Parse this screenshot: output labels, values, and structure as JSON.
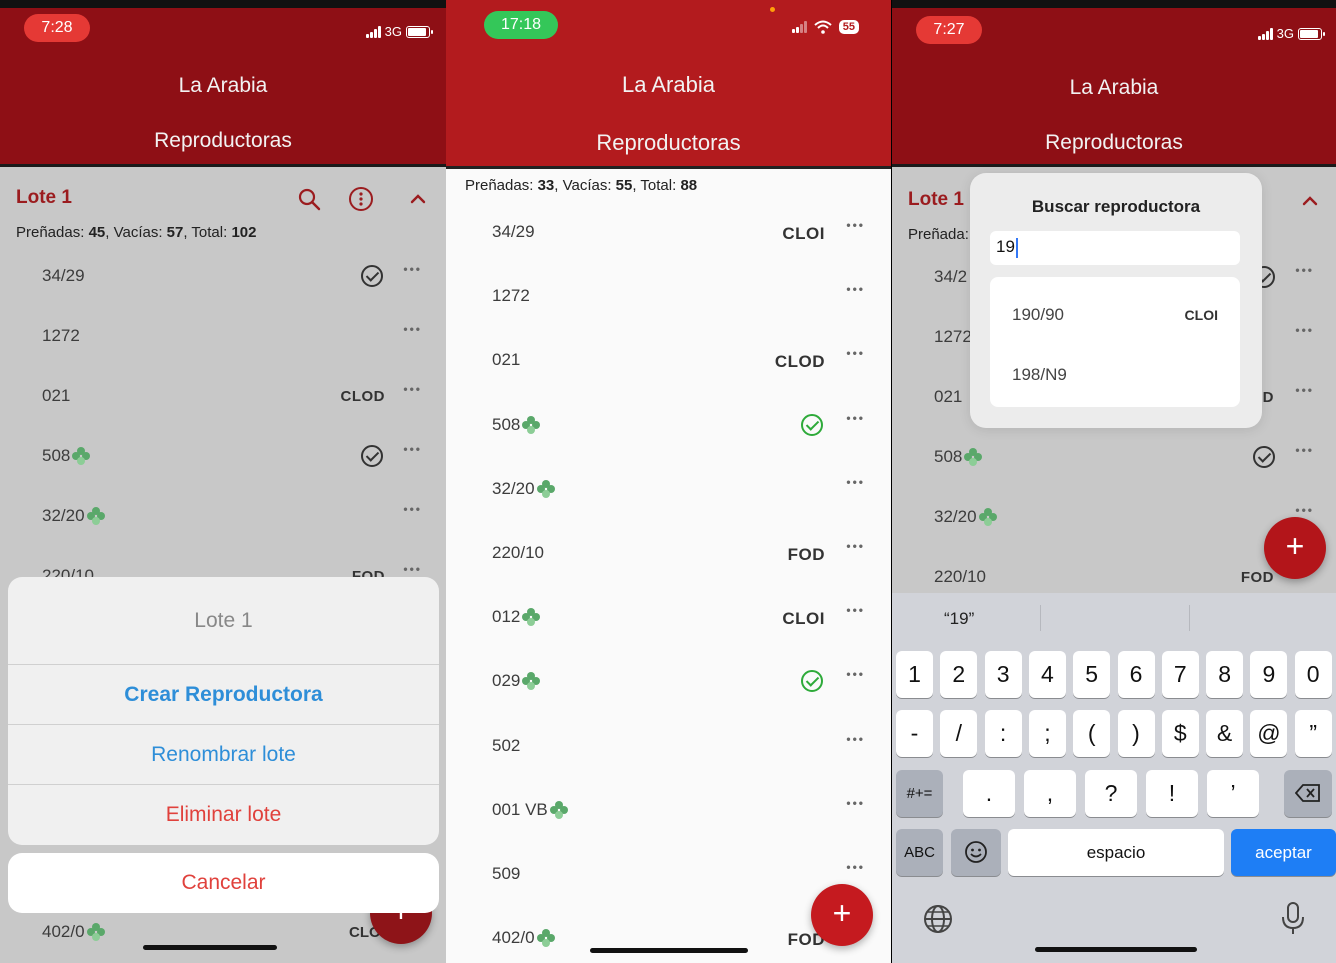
{
  "screen1": {
    "status": {
      "time": "7:28",
      "network": "3G"
    },
    "app_title": "La Arabia",
    "app_subtitle": "Reproductoras",
    "lote": {
      "name": "Lote 1"
    },
    "summary": {
      "prenadas_label": "Preñadas:",
      "prenadas": "45",
      "vacias_label": ", Vacías:",
      "vacias": "57",
      "total_label": ", Total:",
      "total": "102"
    },
    "rows": [
      {
        "code": "34/29",
        "tag": "",
        "check": true,
        "clover": false
      },
      {
        "code": "1272",
        "tag": "",
        "check": false,
        "clover": false
      },
      {
        "code": "021",
        "tag": "CLOD",
        "check": false,
        "clover": false
      },
      {
        "code": "508",
        "tag": "",
        "check": true,
        "clover": true
      },
      {
        "code": "32/20",
        "tag": "",
        "check": false,
        "clover": true
      },
      {
        "code": "220/10",
        "tag": "FOD",
        "check": false,
        "clover": false
      }
    ],
    "bottom_row": {
      "code": "402/0",
      "tag": "CLO"
    },
    "action_sheet": {
      "title": "Lote 1",
      "create": "Crear Reproductora",
      "rename": "Renombrar lote",
      "delete": "Eliminar lote",
      "cancel": "Cancelar"
    },
    "fab": "+",
    "dots": "•••",
    "colors": {
      "header": "#8e0f15",
      "accent_red": "#c8242a",
      "link_blue": "#2e8ed8",
      "destructive": "#e0413c"
    },
    "icons": {
      "search": "search-icon",
      "info": "info-icon",
      "collapse": "chevron-up-icon"
    }
  },
  "screen2": {
    "status": {
      "time": "17:18",
      "battery": "55"
    },
    "app_title": "La Arabia",
    "app_subtitle": "Reproductoras",
    "summary": {
      "prenadas_label": "Preñadas:",
      "prenadas": "33",
      "vacias_label": ", Vacías:",
      "vacias": "55",
      "total_label": ", Total:",
      "total": "88"
    },
    "rows": [
      {
        "code": "34/29",
        "tag": "CLOI",
        "check": false,
        "clover": false
      },
      {
        "code": "1272",
        "tag": "",
        "check": false,
        "clover": false
      },
      {
        "code": "021",
        "tag": "CLOD",
        "check": false,
        "clover": false
      },
      {
        "code": "508",
        "tag": "",
        "check": true,
        "clover": true
      },
      {
        "code": "32/20",
        "tag": "",
        "check": false,
        "clover": true
      },
      {
        "code": "220/10",
        "tag": "FOD",
        "check": false,
        "clover": false
      },
      {
        "code": "012",
        "tag": "CLOI",
        "check": false,
        "clover": true
      },
      {
        "code": "029",
        "tag": "",
        "check": true,
        "clover": true
      },
      {
        "code": "502",
        "tag": "",
        "check": false,
        "clover": false
      },
      {
        "code": "001 VB",
        "tag": "",
        "check": false,
        "clover": true
      },
      {
        "code": "509",
        "tag": "",
        "check": false,
        "clover": false
      },
      {
        "code": "402/0",
        "tag": "FOD",
        "check": false,
        "clover": true
      }
    ],
    "fab": "+",
    "dots": "•••",
    "colors": {
      "header": "#b31b1e",
      "check_green": "#2eaa3a"
    }
  },
  "screen3": {
    "status": {
      "time": "7:27",
      "network": "3G"
    },
    "app_title": "La Arabia",
    "app_subtitle": "Reproductoras",
    "lote": {
      "name": "Lote 1"
    },
    "summary_partial": "Preñada:",
    "rows": [
      {
        "code": "34/2",
        "tag": ""
      },
      {
        "code": "1272",
        "tag": ""
      },
      {
        "code": "021",
        "tag": "D"
      },
      {
        "code": "508",
        "tag": ""
      },
      {
        "code": "32/20",
        "tag": ""
      },
      {
        "code": "220/10",
        "tag": "FOD"
      }
    ],
    "dialog": {
      "title": "Buscar reproductora",
      "query": "19",
      "results": [
        {
          "code": "190/90",
          "tag": "CLOI"
        },
        {
          "code": "198/N9",
          "tag": ""
        }
      ]
    },
    "keyboard": {
      "suggestion": "“19”",
      "row1": [
        "1",
        "2",
        "3",
        "4",
        "5",
        "6",
        "7",
        "8",
        "9",
        "0"
      ],
      "row2": [
        "-",
        "/",
        ":",
        ";",
        "(",
        ")",
        "$",
        "&",
        "@",
        "”"
      ],
      "row3_mode": "#+=",
      "row3": [
        ".",
        ",",
        "?",
        "!",
        "’"
      ],
      "abc": "ABC",
      "space": "espacio",
      "accept": "aceptar"
    },
    "fab": "+",
    "dots": "•••",
    "icons": {
      "emoji": "emoji-icon",
      "globe": "globe-icon",
      "mic": "mic-icon",
      "backspace": "backspace-icon"
    }
  }
}
